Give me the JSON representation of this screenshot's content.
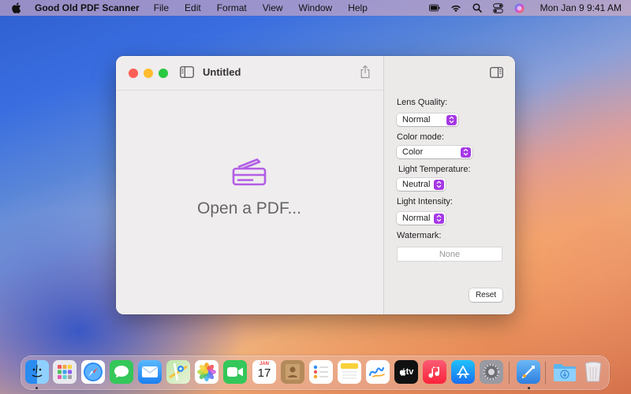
{
  "menubar": {
    "app_name": "Good Old PDF Scanner",
    "menus": [
      "File",
      "Edit",
      "Format",
      "View",
      "Window",
      "Help"
    ],
    "clock": "Mon Jan 9  9:41 AM",
    "status_icons": [
      "battery-icon",
      "wifi-icon",
      "spotlight-search-icon",
      "control-center-icon",
      "siri-icon"
    ]
  },
  "window": {
    "title": "Untitled",
    "open_prompt": "Open a PDF...",
    "accent": "#a638e6"
  },
  "inspector": {
    "lens_quality": {
      "label": "Lens Quality:",
      "value": "Normal"
    },
    "color_mode": {
      "label": "Color mode:",
      "value": "Color"
    },
    "light_temperature": {
      "label": "Light Temperature:",
      "value": "Neutral"
    },
    "light_intensity": {
      "label": "Light Intensity:",
      "value": "Normal"
    },
    "watermark": {
      "label": "Watermark:",
      "placeholder": "None"
    },
    "reset_label": "Reset"
  },
  "dock": {
    "calendar_month": "JAN",
    "calendar_day": "17",
    "tv_label": "tv",
    "apps": [
      "finder",
      "launchpad",
      "safari",
      "messages",
      "mail",
      "maps",
      "photos",
      "facetime",
      "contacts",
      "reminders",
      "notes",
      "freeform",
      "tv",
      "music",
      "app-store",
      "system-settings",
      "pdf-scanner",
      "downloads",
      "trash"
    ]
  }
}
